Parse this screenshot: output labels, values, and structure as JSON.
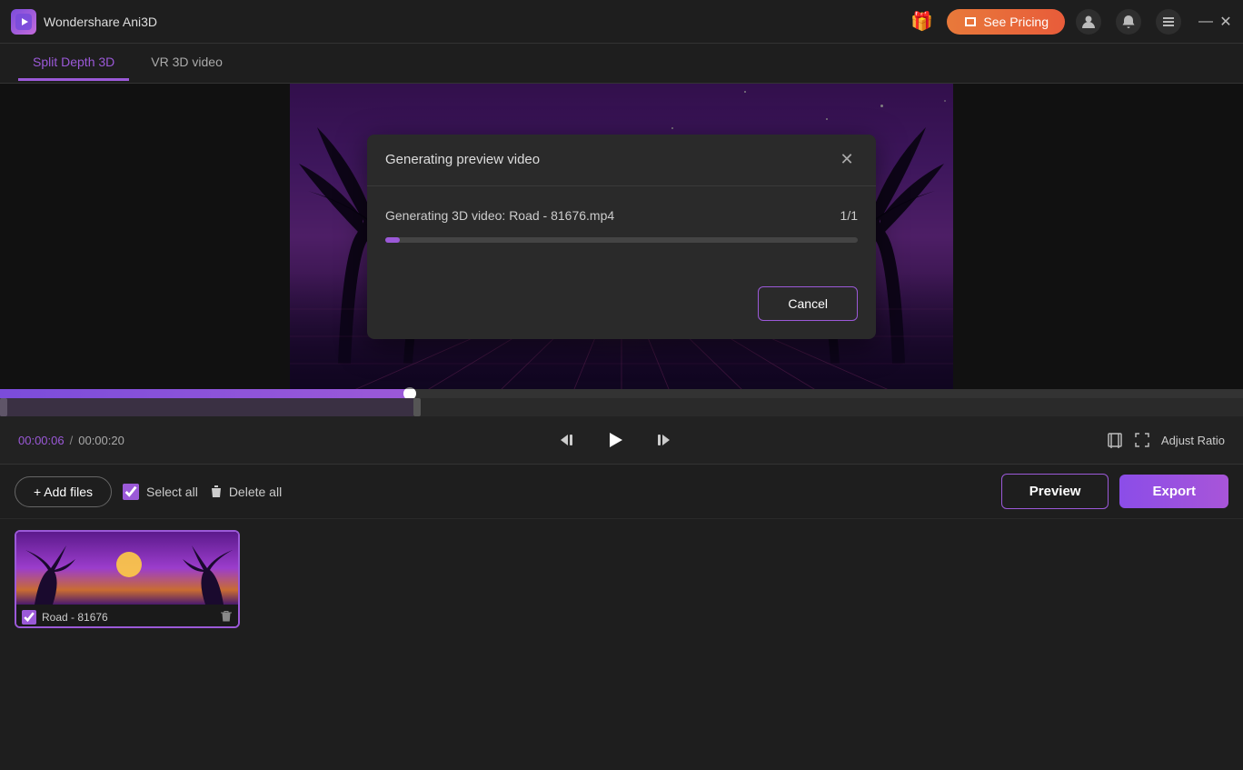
{
  "app": {
    "title": "Wondershare Ani3D",
    "logo_char": "🎬"
  },
  "titlebar": {
    "gift_icon": "🎁",
    "see_pricing_label": "See Pricing",
    "minimize_char": "—",
    "close_char": "✕"
  },
  "tabs": [
    {
      "id": "split-depth",
      "label": "Split Depth 3D",
      "active": true
    },
    {
      "id": "vr-3d",
      "label": "VR 3D video",
      "active": false
    }
  ],
  "timeline": {
    "current_time": "00:00:06",
    "total_time": "00:00:20",
    "progress_percent": 33
  },
  "controls": {
    "skip_back_label": "⏮",
    "play_label": "▶",
    "skip_forward_label": "⏭",
    "fit_screen_label": "⛶",
    "adjust_ratio_label": "Adjust Ratio"
  },
  "toolbar": {
    "add_files_label": "+ Add files",
    "select_all_label": "Select all",
    "delete_all_label": "Delete all",
    "preview_label": "Preview",
    "export_label": "Export"
  },
  "dialog": {
    "title": "Generating preview video",
    "file_text": "Generating 3D video: Road - 81676.mp4",
    "progress_count": "1/1",
    "progress_percent": 3,
    "cancel_label": "Cancel"
  },
  "files": [
    {
      "name": "Road - 81676",
      "selected": true
    }
  ],
  "colors": {
    "accent": "#9b59d8",
    "orange": "#e8793a"
  }
}
